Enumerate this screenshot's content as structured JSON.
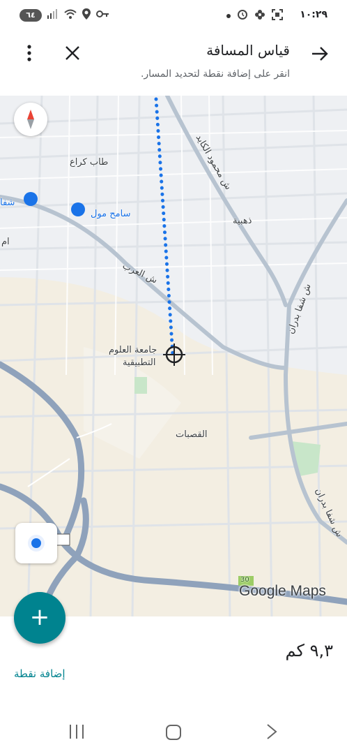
{
  "status_bar": {
    "time": "١٠:٢٩",
    "battery": "٦٤"
  },
  "header": {
    "title": "قياس المسافة",
    "subtitle": "انقر على إضافة نقطة لتحديد المسار."
  },
  "map": {
    "labels": {
      "tab_kraa": "طاب كراع",
      "sameh_mall": "سامح مول",
      "shafa_left": "شفا",
      "um": "ام",
      "dhahiya": "ذهبية",
      "street_arab": "ش العرب",
      "street_mahmoud": "ش محمود الكايد",
      "street_shafa_badran_1": "ش شفا بدران",
      "street_shafa_badran_2": "ش شفا بدران",
      "university_line1": "جامعة العلوم",
      "university_line2": "التطبيقية",
      "qusbat": "القصبات",
      "route_badge": "30"
    },
    "brand": "Google Maps",
    "colors": {
      "route": "#1a73e8",
      "park": "#c8e6c9",
      "road": "#b7c3d0"
    }
  },
  "result": {
    "distance": "٩,٣ كم",
    "add_point": "إضافة نقطة"
  },
  "icons": {
    "back": "arrow-icon",
    "close": "close-icon",
    "menu": "more-vert-icon",
    "compass": "compass-icon",
    "location": "my-location-icon",
    "add": "plus-icon"
  }
}
